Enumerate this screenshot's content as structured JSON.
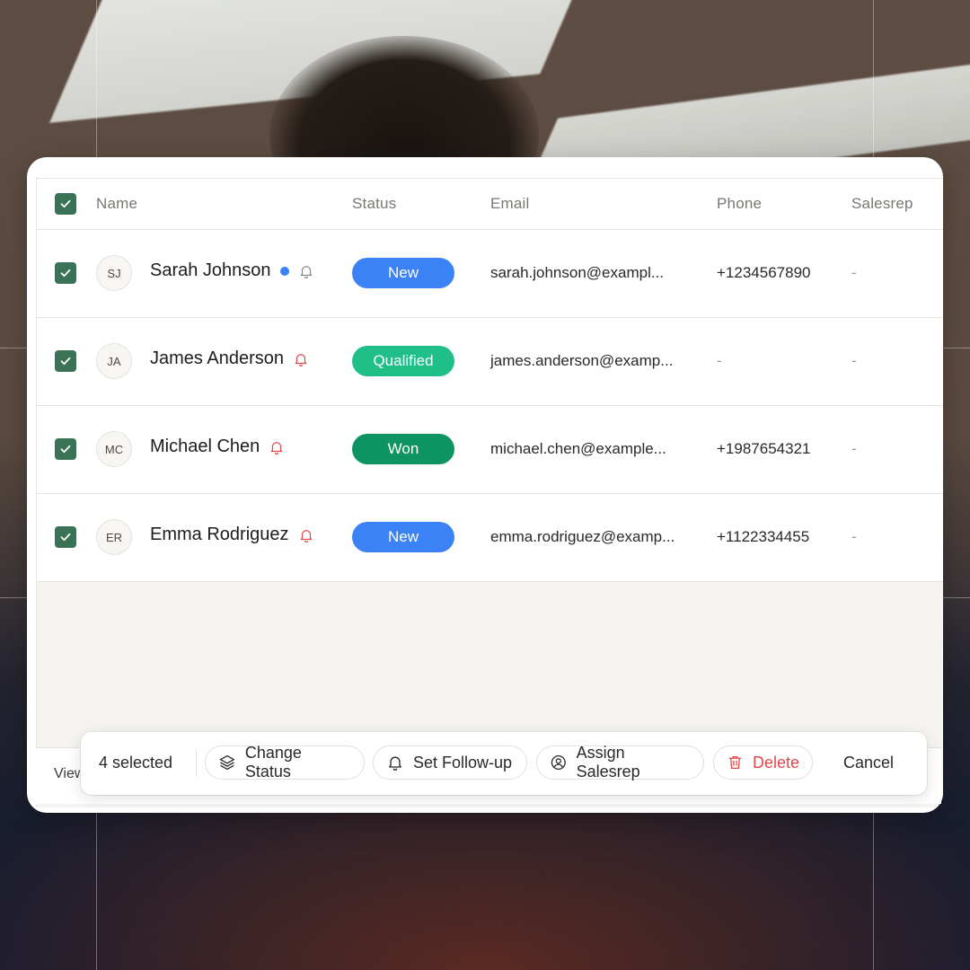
{
  "table": {
    "columns": {
      "name": "Name",
      "status": "Status",
      "email": "Email",
      "phone": "Phone",
      "salesrep": "Salesrep"
    },
    "rows": [
      {
        "initials": "SJ",
        "name": "Sarah Johnson",
        "status": "New",
        "email": "sarah.johnson@exampl...",
        "phone": "+1234567890",
        "salesrep": "-"
      },
      {
        "initials": "JA",
        "name": "James Anderson",
        "status": "Qualified",
        "email": "james.anderson@examp...",
        "phone": "-",
        "salesrep": "-"
      },
      {
        "initials": "MC",
        "name": "Michael Chen",
        "status": "Won",
        "email": "michael.chen@example...",
        "phone": "+1987654321",
        "salesrep": "-"
      },
      {
        "initials": "ER",
        "name": "Emma Rodriguez",
        "status": "New",
        "email": "emma.rodriguez@examp...",
        "phone": "+1122334455",
        "salesrep": "-"
      }
    ]
  },
  "footer": {
    "view_label": "View"
  },
  "action_bar": {
    "selected_label": "4 selected",
    "change_status": "Change Status",
    "set_followup": "Set Follow-up",
    "assign_salesrep": "Assign Salesrep",
    "delete": "Delete",
    "cancel": "Cancel"
  },
  "colors": {
    "checkbox": "#3a7256",
    "status_new": "#3b82f6",
    "status_qualified": "#1fbf87",
    "status_won": "#0e9463",
    "danger": "#e04848",
    "unread_dot": "#3b82f6"
  },
  "icons": {
    "check": "check-icon",
    "bell": "bell-icon",
    "layers": "layers-icon",
    "user_circle": "user-circle-icon",
    "trash": "trash-icon"
  }
}
